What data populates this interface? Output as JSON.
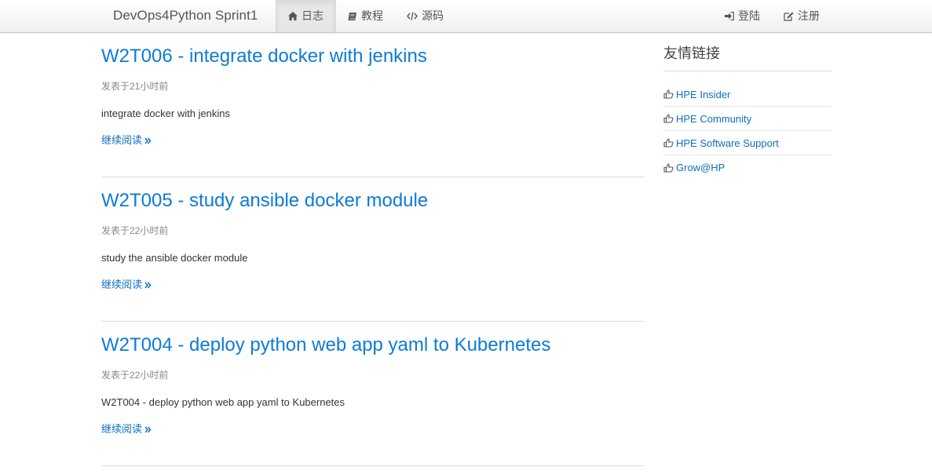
{
  "navbar": {
    "brand": "DevOps4Python Sprint1",
    "left_items": [
      {
        "label": "日志",
        "icon": "home-icon",
        "active": true
      },
      {
        "label": "教程",
        "icon": "book-icon",
        "active": false
      },
      {
        "label": "源码",
        "icon": "code-icon",
        "active": false
      }
    ],
    "right_items": [
      {
        "label": "登陆",
        "icon": "sign-in-icon"
      },
      {
        "label": "注册",
        "icon": "edit-icon"
      }
    ]
  },
  "posts": [
    {
      "title": "W2T006 - integrate docker with jenkins",
      "meta": "发表于21小时前",
      "summary": "integrate docker with jenkins",
      "read_more": "继续阅读"
    },
    {
      "title": "W2T005 - study ansible docker module",
      "meta": "发表于22小时前",
      "summary": "study the ansible docker module",
      "read_more": "继续阅读"
    },
    {
      "title": "W2T004 - deploy python web app yaml to Kubernetes",
      "meta": "发表于22小时前",
      "summary": "W2T004 - deploy python web app yaml to Kubernetes",
      "read_more": "继续阅读"
    }
  ],
  "sidebar": {
    "title": "友情链接",
    "links": [
      {
        "label": "HPE Insider",
        "icon": "thumbs-up-icon"
      },
      {
        "label": "HPE Community",
        "icon": "thumbs-up-icon"
      },
      {
        "label": "HPE Software Support",
        "icon": "thumbs-up-icon"
      },
      {
        "label": "Grow@HP",
        "icon": "thumbs-up-icon"
      }
    ]
  },
  "colors": {
    "link": "#0d7bd6",
    "navbar_bg": "#f5f5f5",
    "text": "#333333",
    "muted": "#888888"
  }
}
